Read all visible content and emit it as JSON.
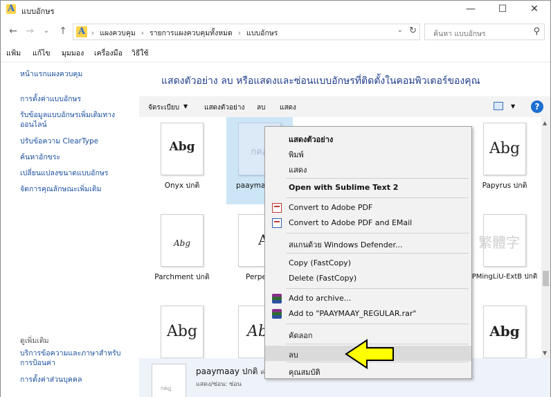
{
  "window": {
    "title": "แบบอักษร",
    "controls": {
      "minimize": "—",
      "maximize": "☐",
      "close": "✕"
    }
  },
  "nav": {
    "back": "←",
    "forward": "→",
    "recent": "⌄",
    "up": "↑",
    "breadcrumbs": [
      "แผงควบคุม",
      "รายการแผงควบคุมทั้งหมด",
      "แบบอักษร"
    ],
    "search_placeholder": "ค้นหา แบบอักษร"
  },
  "menubar": [
    "แฟ้ม",
    "แก้ไข",
    "มุมมอง",
    "เครื่องมือ",
    "วิธีใช้"
  ],
  "left_pane": {
    "home": "หน้าแรกแผงควบคุม",
    "links": [
      "การตั้งค่าแบบอักษร",
      "รับข้อมูลแบบอักษรเพิ่มเติมทางออนไลน์",
      "ปรับข้อความ ClearType",
      "ค้นหาอักขระ",
      "เปลี่ยนแปลงขนาดแบบอักษร",
      "จัดการคุณลักษณะเพิ่มเติม"
    ],
    "see_also": "ดูเพิ่มเติม",
    "see_also_links": [
      "บริการข้อความและภาษาสำหรับการป้อนค่า",
      "การตั้งค่าส่วนบุคคล"
    ]
  },
  "main": {
    "heading": "แสดงตัวอย่าง ลบ หรือแสดงและซ่อนแบบอักษรที่ติดตั้งในคอมพิวเตอร์ของคุณ",
    "toolbar": [
      "จัดระเบียบ",
      "แสดงตัวอย่าง",
      "ลบ",
      "แสดง"
    ],
    "help": "?",
    "fonts": [
      {
        "label": "Onyx ปกติ",
        "glyph": "Abg"
      },
      {
        "label": "paayma",
        "glyph": "กคฎ"
      },
      {
        "label": "",
        "glyph": ""
      },
      {
        "label": "",
        "glyph": ""
      },
      {
        "label": "Papyrus ปกติ",
        "glyph": "Abg"
      },
      {
        "label": "Parchment ปกติ",
        "glyph": "Abg"
      },
      {
        "label": "Perpe",
        "glyph": "Ab"
      },
      {
        "label": "",
        "glyph": ""
      },
      {
        "label": "",
        "glyph": ""
      },
      {
        "label": "PMingLiU-ExtB ปกติ",
        "glyph": "繁體字"
      },
      {
        "label": "",
        "glyph": "Abg"
      },
      {
        "label": "",
        "glyph": "Ab"
      },
      {
        "label": "",
        "glyph": ""
      },
      {
        "label": "",
        "glyph": ""
      },
      {
        "label": "",
        "glyph": "Abg"
      }
    ]
  },
  "details": {
    "name": "paaymaay ปกติ",
    "name_suffix": "ค่",
    "sub": "แสดง/ซ่อน:  ซ่อน",
    "thumb": "กคฎ"
  },
  "context_menu": {
    "items": [
      {
        "label": "แสดงตัวอย่าง",
        "bold": true
      },
      {
        "label": "พิมพ์"
      },
      {
        "label": "แสดง"
      },
      {
        "label": "Open with Sublime Text 2",
        "bold": true
      },
      {
        "label": "Convert to Adobe PDF",
        "icon": "pdf-icon"
      },
      {
        "label": "Convert to Adobe PDF and EMail",
        "icon": "pdf-email-icon"
      },
      {
        "label": "สแกนด้วย Windows Defender..."
      },
      {
        "label": "Copy  (FastCopy)"
      },
      {
        "label": "Delete (FastCopy)"
      },
      {
        "label": "Add to archive...",
        "icon": "winrar-icon"
      },
      {
        "label": "Add to \"PAAYMAAY_REGULAR.rar\"",
        "icon": "winrar-icon"
      },
      {
        "label": "คัดลอก"
      },
      {
        "label": "ลบ",
        "highlight": true
      },
      {
        "label": "คุณสมบัติ"
      }
    ]
  },
  "annotation": {
    "arrow_color": "#ffff00",
    "arrow_outline": "#000000"
  }
}
